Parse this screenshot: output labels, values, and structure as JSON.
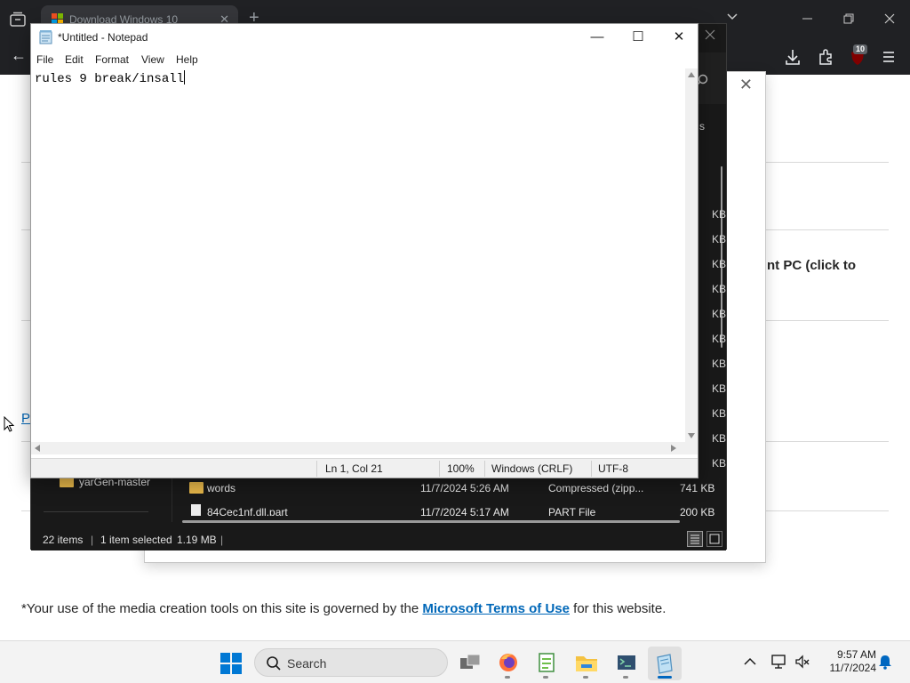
{
  "browser": {
    "tab_title": "Download Windows 10",
    "tab_close": "✕",
    "new_tab": "+",
    "extension_badge": "10",
    "page_fragment_heading": "nt PC (click to",
    "page_link_fragment": "P",
    "footnote_before": "*Your use of the media creation tools on this site is governed by the ",
    "footnote_link": "Microsoft Terms of Use",
    "footnote_after": " for this website."
  },
  "dialog": {
    "close_glyph": "✕"
  },
  "explorer": {
    "column_fragment": "s",
    "size_column": [
      "KB",
      "KB",
      "KB",
      "KB",
      "KB",
      "KB",
      "KB",
      "KB",
      "KB",
      "KB",
      "KB"
    ],
    "nav_item": "yarGen-master",
    "files": [
      {
        "name": "words",
        "date": "11/7/2024 5:26 AM",
        "type": "Compressed (zipp...",
        "size": "741 KB",
        "icon": "folder-zip-icon"
      },
      {
        "name": "84Cec1nf.dll.part",
        "date": "11/7/2024 5:17 AM",
        "type": "PART File",
        "size": "200 KB",
        "icon": "file-icon"
      }
    ],
    "status": {
      "items": "22 items",
      "selected": "1 item selected",
      "size": "1.19 MB"
    }
  },
  "notepad": {
    "title": "*Untitled - Notepad",
    "menu": [
      "File",
      "Edit",
      "Format",
      "View",
      "Help"
    ],
    "content": "rules 9 break/insall",
    "status": {
      "position": "Ln 1, Col 21",
      "zoom": "100%",
      "line_ending": "Windows (CRLF)",
      "encoding": "UTF-8"
    },
    "buttons": {
      "minimize": "—",
      "maximize": "☐",
      "close": "✕"
    }
  },
  "taskbar": {
    "search_label": "Search",
    "time": "9:57 AM",
    "date": "11/7/2024",
    "apps": [
      "task-view",
      "firefox",
      "notepad-plus",
      "file-explorer",
      "terminal-app",
      "notepad"
    ]
  },
  "colors": {
    "accent": "#0078d4",
    "link": "#0067b8",
    "explorer_bg": "#191919",
    "browser_bg": "#202124",
    "folder": "#e8b84a"
  }
}
